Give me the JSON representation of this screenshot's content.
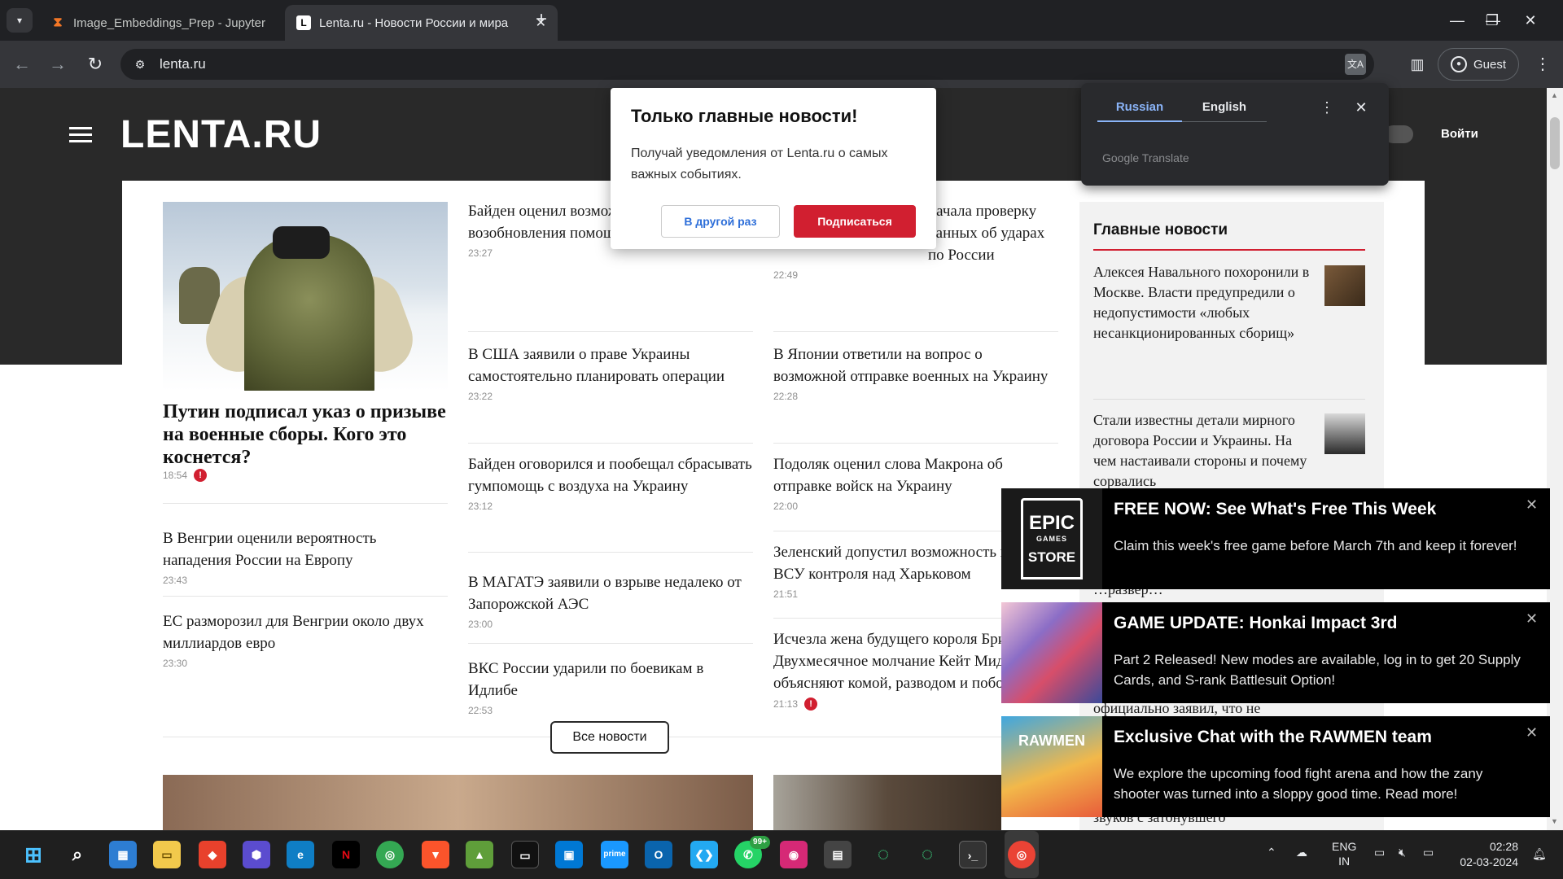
{
  "browser": {
    "tabs": [
      {
        "title": "Image_Embeddings_Prep - Jupyter",
        "favicon": "jupyter-hourglass-icon",
        "active": false
      },
      {
        "title": "Lenta.ru - Новости России и мира",
        "favicon": "lenta-l-icon",
        "active": true
      }
    ],
    "url": "lenta.ru",
    "profile": "Guest",
    "icons": {
      "tab_search": "▾",
      "new_tab": "+",
      "minimize": "—",
      "maximize": "❐",
      "close": "✕",
      "back": "←",
      "forward": "→",
      "reload": "↻",
      "site_info": "⚙",
      "translate": "文A",
      "side_panel": "▥",
      "menu": "⋮",
      "tab_close": "✕"
    }
  },
  "site": {
    "logo": "LENTA.RU",
    "login": "Войти",
    "hero": {
      "title": "Путин подписал указ о призыве на военные сборы. Кого это коснется?",
      "time": "18:54"
    },
    "col1": [
      {
        "title": "В Венгрии оценили вероятность нападения России на Европу",
        "time": "23:43"
      },
      {
        "title": "ЕС разморозил для Венгрии около двух миллиардов евро",
        "time": "23:30"
      }
    ],
    "col2": [
      {
        "title": "Байден оценил возможность возобновления помощи Украине",
        "time": "23:27"
      },
      {
        "title": "В США заявили о праве Украины самостоятельно планировать операции",
        "time": "23:22"
      },
      {
        "title": "Байден оговорился и пообещал сбрасывать гумпомощь с воздуха на Украину",
        "time": "23:12"
      },
      {
        "title": "В МАГАТЭ заявили о взрыве недалеко от Запорожской АЭС",
        "time": "23:00"
      },
      {
        "title": "ВКС России ударили по боевикам в Идлибе",
        "time": "22:53"
      }
    ],
    "col3": [
      {
        "title": "начала проверку данных об ударах по России",
        "time": "22:49"
      },
      {
        "title": "В Японии ответили на вопрос о возможной отправке военных на Украину",
        "time": "22:28"
      },
      {
        "title": "Подоляк оценил слова Макрона об отправке войск на Украину",
        "time": "22:00"
      },
      {
        "title": "Зеленский допустил возможность потери ВСУ контроля над Харьковом",
        "time": "21:51"
      },
      {
        "title": "Исчезла жена будущего короля Британии. Двухмесячное молчание Кейт Миддлтон объясняют комой, разводом и побоями",
        "time": "21:13"
      }
    ],
    "all_news": "Все новости",
    "rail": {
      "title": "Главные новости",
      "items": [
        {
          "title": "Алексея Навального похоронили в Москве. Власти предупредили о недопустимости «любых несанкционированных сборищ»"
        },
        {
          "title": "Стали известны детали мирного договора России и Украины. На чем настаивали стороны и почему сорвались"
        }
      ],
      "peek": [
        "…развёр…",
        "официально заявил, что не",
        "звуков с затонувшего"
      ]
    },
    "popup": {
      "title": "Только главные новости!",
      "body": "Получай уведомления от Lenta.ru о самых важных событиях.",
      "later": "В другой раз",
      "subscribe": "Подписаться"
    }
  },
  "translate": {
    "lang_from": "Russian",
    "lang_to": "English",
    "brand": "Google Translate"
  },
  "toasts": [
    {
      "title": "FREE NOW: See What's Free This Week",
      "body": "Claim this week's free game before March 7th and keep it forever!",
      "image": "epic-games-store-logo",
      "logo_top": "EPIC",
      "logo_mid": "GAMES",
      "logo_bottom": "STORE"
    },
    {
      "title": "GAME UPDATE: Honkai Impact 3rd",
      "body": "Part 2 Released! New modes are available, log in to get 20 Supply Cards, and S-rank Battlesuit Option!",
      "image": "honkai-artwork"
    },
    {
      "title": "Exclusive Chat with the RAWMEN team",
      "body": "We explore the upcoming food fight arena and how the zany shooter was turned into a sloppy good time. Read more!",
      "image": "rawmen-artwork",
      "image_text": "RAWMEN"
    }
  ],
  "taskbar": {
    "whatsapp_badge": "99+",
    "lang_line1": "ENG",
    "lang_line2": "IN",
    "time": "02:28",
    "date": "02-03-2024"
  },
  "colors": {
    "accent": "#d11f30",
    "dark_header": "#292929",
    "link_blue": "#8ab4f8"
  }
}
